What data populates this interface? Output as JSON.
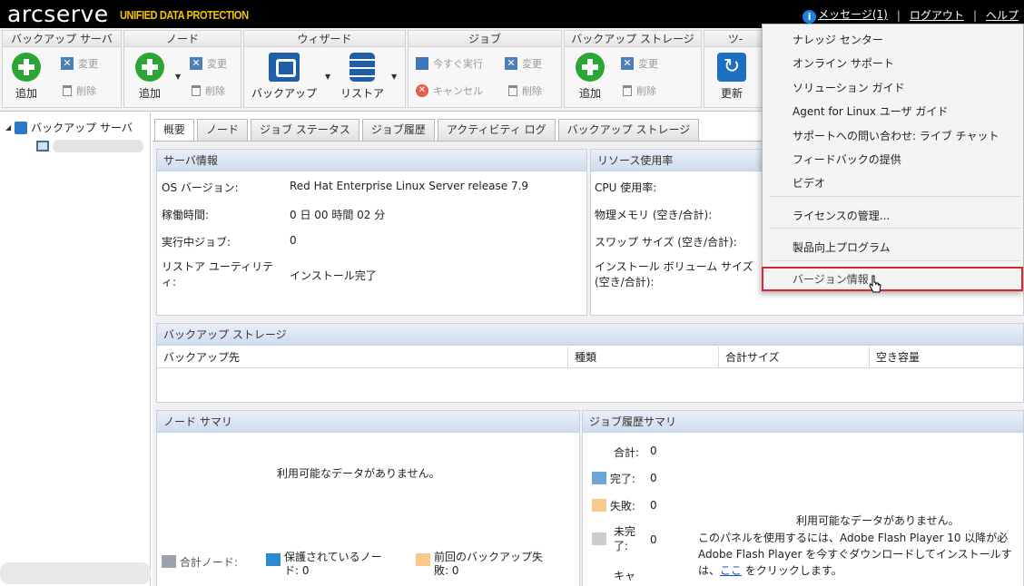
{
  "brand": {
    "logo": "arcserve",
    "product": "UNIFIED DATA PROTECTION"
  },
  "top_links": {
    "messages": "メッセージ(1)",
    "logout": "ログアウト",
    "help": "ヘルプ",
    "separator": "|"
  },
  "toolbar": {
    "groups": {
      "backup_server": "バックアップ サーバ",
      "node": "ノード",
      "wizard": "ウィザード",
      "job": "ジョブ",
      "backup_storage": "バックアップ ストレージ",
      "tools": "ツ-"
    },
    "add": "追加",
    "change": "変更",
    "delete": "削除",
    "backup": "バックアップ",
    "restore": "リストア",
    "run_now": "今すぐ実行",
    "cancel": "キャンセル",
    "refresh": "更新"
  },
  "tree": {
    "root": "バックアップ サーバ"
  },
  "tabs": [
    "概要",
    "ノード",
    "ジョブ ステータス",
    "ジョブ履歴",
    "アクティビティ ログ",
    "バックアップ ストレージ"
  ],
  "server_info": {
    "title": "サーバ情報",
    "os_label": "OS バージョン:",
    "os_value": "Red Hat Enterprise Linux Server release 7.9",
    "uptime_label": "稼働時間:",
    "uptime_value": "0 日 00 時間 02 分",
    "running_label": "実行中ジョブ:",
    "running_value": "0",
    "restore_label": "リストア ユーティリティ:",
    "restore_value": "インストール完了"
  },
  "resource": {
    "title": "リソース使用率",
    "cpu": "CPU 使用率:",
    "mem": "物理メモリ (空き/合計):",
    "swap": "スワップ サイズ (空き/合計):",
    "volume": "インストール ボリューム サイズ (空き/合計):"
  },
  "backup_storage": {
    "title": "バックアップ ストレージ",
    "columns": [
      "バックアップ先",
      "種類",
      "合計サイズ",
      "空き容量"
    ]
  },
  "node_summary": {
    "title": "ノード サマリ",
    "no_data": "利用可能なデータがありません。",
    "total_nodes": "合計ノード:",
    "protected": "保護されているノード: 0",
    "last_failed": "前回のバックアップ失敗: 0"
  },
  "job_summary": {
    "title": "ジョブ履歴サマリ",
    "total_label": "合計:",
    "total_value": "0",
    "done_label": "完了:",
    "done_value": "0",
    "failed_label": "失敗:",
    "failed_value": "0",
    "incomplete_label": "未完了:",
    "incomplete_value": "0",
    "cancel_label": "キャ",
    "no_data": "利用可能なデータがありません。",
    "flash_line1": "このパネルを使用するには、Adobe Flash Player 10 以降が必",
    "flash_line2": "Adobe Flash Player を今すぐダウンロードしてインストールす",
    "flash_line3_pre": "は、",
    "flash_link": "ここ",
    "flash_line3_post": " をクリックします。"
  },
  "help_menu": {
    "items": [
      "ナレッジ センター",
      "オンライン サポート",
      "ソリューション ガイド",
      "Agent for Linux ユーザ ガイド",
      "サポートへの問い合わせ: ライブ チャット",
      "フィードバックの提供",
      "ビデオ",
      "ライセンスの管理...",
      "製品向上プログラム",
      "バージョン情報"
    ]
  },
  "colors": {
    "accent_green": "#2aa634",
    "brand_yellow": "#f5c400",
    "highlight_red": "#d8252f",
    "done": "#6ea6d8",
    "failed": "#f7c98a",
    "incomplete": "#c8cdd1"
  }
}
